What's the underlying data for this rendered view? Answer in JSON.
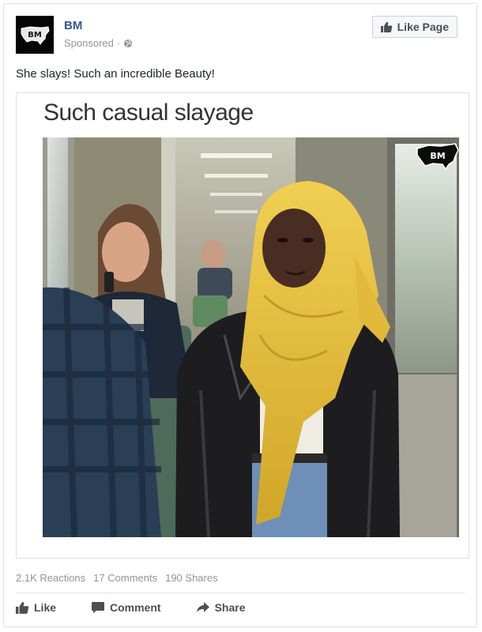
{
  "page": {
    "name": "BM",
    "sponsored_label": "Sponsored",
    "sponsored_separator": "·",
    "avatar_text": "BM"
  },
  "header": {
    "like_page_label": "Like Page"
  },
  "post": {
    "text": "She slays! Such an incredible Beauty!"
  },
  "media": {
    "caption": "Such casual slayage",
    "watermark_text": "BM"
  },
  "stats": {
    "reactions": "2.1K Reactions",
    "comments": "17 Comments",
    "shares": "190 Shares"
  },
  "actions": {
    "like_label": "Like",
    "comment_label": "Comment",
    "share_label": "Share"
  },
  "colors": {
    "brand_link": "#365899",
    "muted_text": "#90949c",
    "action_text": "#4b4f56",
    "border": "#dddfe2"
  },
  "icons": {
    "avatar": "usa-map-logo",
    "globe": "globe-icon",
    "like": "thumbs-up-icon",
    "comment": "speech-bubble-icon",
    "share": "share-arrow-icon"
  }
}
